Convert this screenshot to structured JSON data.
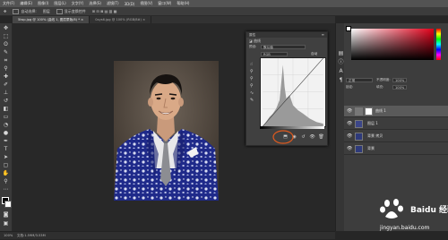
{
  "menu": {
    "items": [
      "文件(F)",
      "编辑(E)",
      "图像(I)",
      "图层(L)",
      "文字(Y)",
      "选择(S)",
      "滤镜(T)",
      "3D(D)",
      "视图(V)",
      "窗口(W)",
      "帮助(H)"
    ]
  },
  "options_bar": {
    "auto_select_label": "自动选择:",
    "auto_select_value": "图层",
    "transform_label": "显示变换控件"
  },
  "tabs": [
    {
      "label": "5lwp.jpg @ 100% (曲线 1, 图层蒙版/8) *",
      "active": true
    },
    {
      "label": "0xys6.jpg @ 100% (RGB/8#)",
      "active": false
    }
  ],
  "properties": {
    "title": "属性",
    "section": "曲线",
    "preset_label": "预设:",
    "preset_value": "默认值",
    "channel_value": "RGB",
    "auto_label": "自动"
  },
  "right_panel": {
    "mode_value": "正常",
    "opacity_label": "不透明度:",
    "opacity_value": "100%",
    "fill_label": "填充:",
    "fill_value": "100%",
    "lock_label": "锁定:"
  },
  "layers": [
    {
      "name": "曲线 1",
      "selected": true,
      "has_mask": true
    },
    {
      "name": "图层 1",
      "selected": false,
      "has_mask": false
    },
    {
      "name": "背景 拷贝",
      "selected": false,
      "has_mask": false
    },
    {
      "name": "背景",
      "selected": false,
      "has_mask": false
    }
  ],
  "status": {
    "zoom": "100%",
    "doc_info": "文档:1.59M/3.53M"
  },
  "watermark": {
    "brand": "Baidu 经验",
    "url": "jingyan.baidu.com"
  },
  "colors": {
    "accent_annotation": "#e05a1e",
    "menubar": "#535353",
    "panel": "#404040"
  }
}
